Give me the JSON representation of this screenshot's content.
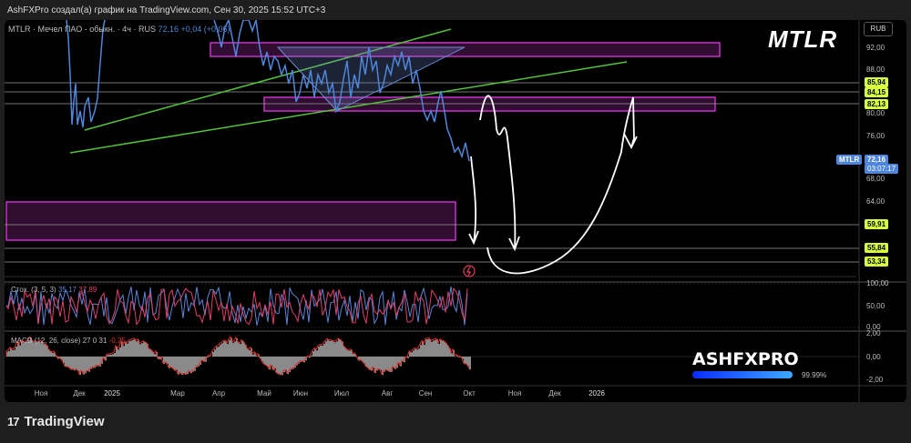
{
  "header": {
    "text": "AshFXPro создал(а) график на TradingView.com, Сен 30, 2025 15:52 UTC+3"
  },
  "legend": {
    "symbol_line": "MTLR · Мечел ПАО - обыкн. · 4ч · RUS",
    "price": "72,16",
    "change": "+0,04 (+0,06)"
  },
  "symbol_big": "MTLR",
  "currency": "RUB",
  "price_tag": {
    "symbol": "MTLR",
    "price": "72,16",
    "countdown": "03:07:17"
  },
  "level_tags": [
    "85,94",
    "84,15",
    "82,13",
    "59,91",
    "55,84",
    "53,34"
  ],
  "stoch_label": {
    "name": "Стох. (3, 5, 3)",
    "k": "35,17",
    "d": "37,89"
  },
  "macd_label": {
    "name": "MACD (12, 26, close)",
    "values": "27  0  31",
    "neg": "-0,25"
  },
  "stoch_axis": [
    "100,00",
    "50,00",
    "0,00"
  ],
  "macd_axis": [
    "2,00",
    "0,00",
    "-2,00"
  ],
  "brand": {
    "name": "ASHFXPRO",
    "percent": "99.99%"
  },
  "footer": {
    "logo": "17",
    "name": "TradingView"
  },
  "colors": {
    "blue_line": "#4f86d9",
    "magenta": "#c832c8",
    "green": "#54c23c",
    "level_tag": "#d7ff3f",
    "price_tag": "#4f86d9"
  },
  "chart_data": {
    "type": "line",
    "xlabels": [
      "Ноя",
      "Дек",
      "2025",
      "Мар",
      "Апр",
      "Май",
      "Июн",
      "Июл",
      "Авг",
      "Сен",
      "Окт",
      "Ноя",
      "Дек",
      "2026"
    ],
    "yticks": [
      "92,00",
      "88,00",
      "80,00",
      "76,00",
      "68,00",
      "64,00"
    ],
    "ylim": [
      50,
      100
    ],
    "price_series": [
      {
        "x": "Ноя",
        "y": 98
      },
      {
        "x": "Ноя",
        "y": 76
      },
      {
        "x": "Дек",
        "y": 78
      },
      {
        "x": "Дек",
        "y": 82
      },
      {
        "x": "2025",
        "y": 97
      },
      {
        "x": "Мар",
        "y": 98
      },
      {
        "x": "Апр",
        "y": 87
      },
      {
        "x": "Апр",
        "y": 97
      },
      {
        "x": "Май",
        "y": 90
      },
      {
        "x": "Июн",
        "y": 85
      },
      {
        "x": "Июн",
        "y": 91
      },
      {
        "x": "Июл",
        "y": 80
      },
      {
        "x": "Июл",
        "y": 85
      },
      {
        "x": "Авг",
        "y": 91
      },
      {
        "x": "Авг",
        "y": 87
      },
      {
        "x": "Сен",
        "y": 84
      },
      {
        "x": "Сен",
        "y": 78
      },
      {
        "x": "Окт",
        "y": 72.16
      }
    ],
    "horizontal_levels": [
      85.94,
      84.15,
      82.13,
      59.91,
      55.84,
      53.34
    ],
    "zones": [
      {
        "from": 90.5,
        "to": 92.8,
        "start": "Дек",
        "end": "Окт+"
      },
      {
        "from": 81.5,
        "to": 84.0,
        "start": "Май",
        "end": "Окт+"
      },
      {
        "from": 56.5,
        "to": 63.5,
        "start": "Ноя",
        "end": "Сен"
      }
    ]
  }
}
